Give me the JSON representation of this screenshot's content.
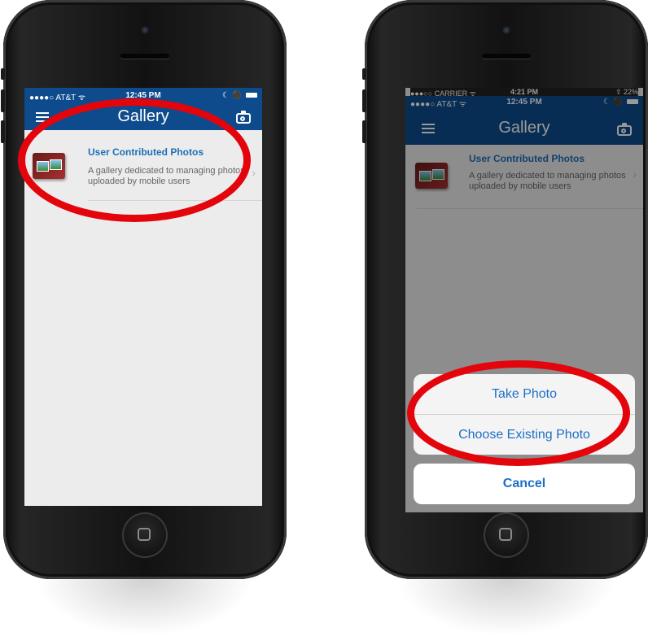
{
  "left_phone": {
    "status": {
      "carrier": "●●●●○ AT&T ᯤ",
      "time": "12:45 PM",
      "right": "☾ ⚫"
    },
    "nav": {
      "title": "Gallery"
    },
    "gallery_item": {
      "title": "User Contributed Photos",
      "description": "A gallery dedicated to managing photos uploaded by mobile users",
      "chevron": "›"
    }
  },
  "right_phone": {
    "old_status": {
      "carrier": "●●●○○ CARRIER ᯤ",
      "time": "4:21 PM",
      "right": "⇪ 22%"
    },
    "status": {
      "carrier": "●●●●○ AT&T ᯤ",
      "time": "12:45 PM",
      "right": "☾ ⚫"
    },
    "nav": {
      "title": "Gallery"
    },
    "gallery_item": {
      "title": "User Contributed Photos",
      "description": "A gallery dedicated to managing photos uploaded by mobile users",
      "chevron": "›"
    },
    "action_sheet": {
      "take_photo": "Take Photo",
      "choose_existing": "Choose Existing Photo",
      "cancel": "Cancel"
    }
  },
  "colors": {
    "nav_bar": "#0d4b8c",
    "highlight_ring": "#e4040c",
    "link_blue": "#1e6fb6",
    "action_blue": "#1d6fc7"
  }
}
